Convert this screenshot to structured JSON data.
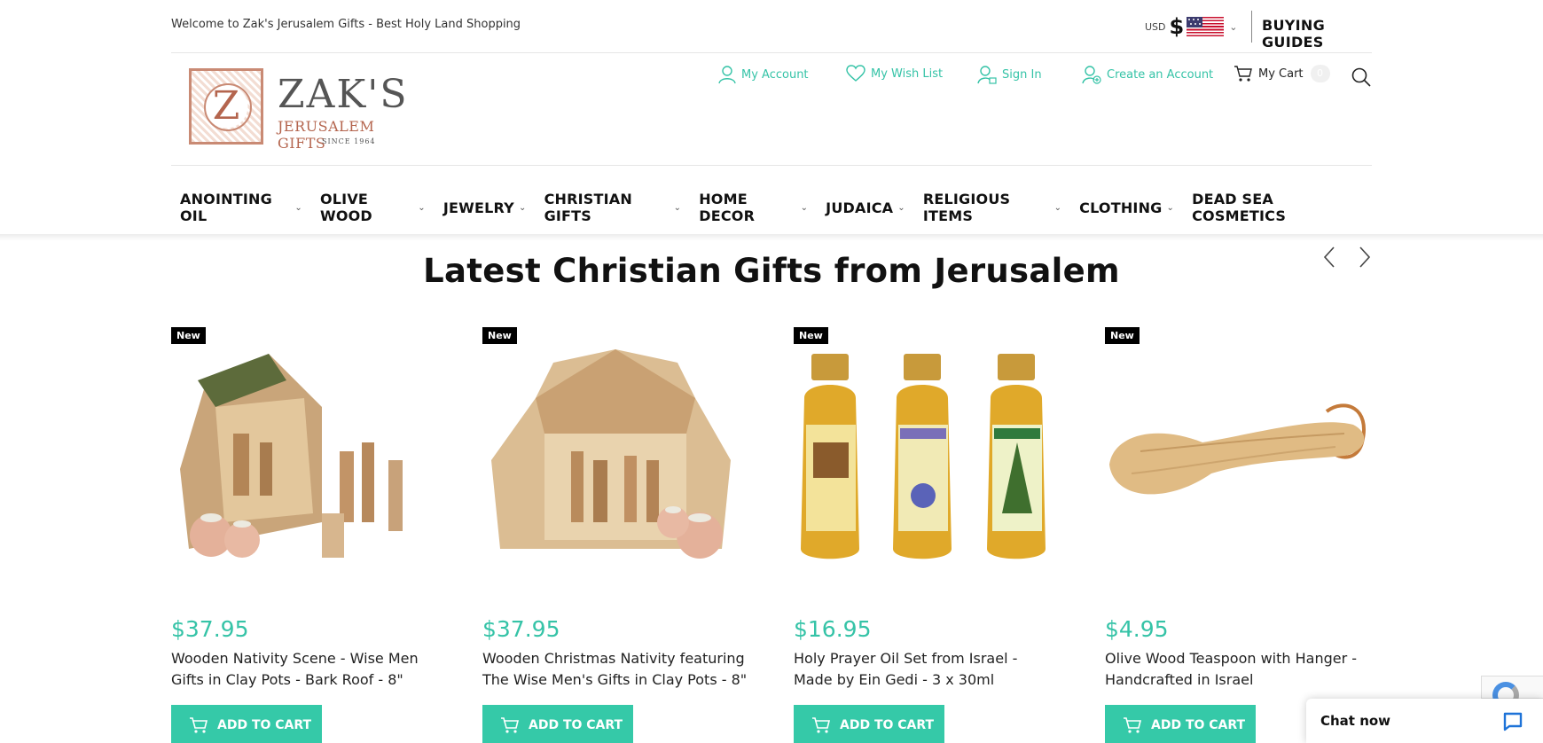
{
  "topbar": {
    "welcome": "Welcome to Zak's Jerusalem Gifts - Best Holy Land Shopping",
    "currency_code": "USD",
    "currency_symbol": "$",
    "buying_guides": "BUYING GUIDES"
  },
  "logo": {
    "mark_letter": "Z",
    "name": "ZAK'S",
    "tagline": "JERUSALEM GIFTS",
    "since": "SINCE 1964"
  },
  "account": {
    "my_account": "My Account",
    "wish_list": "My Wish List",
    "sign_in": "Sign In",
    "create_account": "Create an Account",
    "cart": "My Cart",
    "cart_count": "0"
  },
  "nav": {
    "items": [
      {
        "label": "ANOINTING OIL",
        "has_dropdown": true
      },
      {
        "label": "OLIVE WOOD",
        "has_dropdown": true
      },
      {
        "label": "JEWELRY",
        "has_dropdown": true
      },
      {
        "label": "CHRISTIAN GIFTS",
        "has_dropdown": true
      },
      {
        "label": "HOME DECOR",
        "has_dropdown": true
      },
      {
        "label": "JUDAICA",
        "has_dropdown": true
      },
      {
        "label": "RELIGIOUS ITEMS",
        "has_dropdown": true
      },
      {
        "label": "CLOTHING",
        "has_dropdown": true
      },
      {
        "label": "DEAD SEA COSMETICS",
        "has_dropdown": false
      }
    ]
  },
  "section": {
    "title": "Latest Christian Gifts from Jerusalem",
    "prev_icon": "chevron-left-icon",
    "next_icon": "chevron-right-icon"
  },
  "products": [
    {
      "badge": "New",
      "price": "$37.95",
      "name": "Wooden Nativity Scene - Wise Men Gifts in Clay Pots - Bark Roof - 8\"",
      "button": "ADD TO CART"
    },
    {
      "badge": "New",
      "price": "$37.95",
      "name": "Wooden Christmas Nativity featuring The Wise Men's Gifts in Clay Pots - 8\"",
      "button": "ADD TO CART"
    },
    {
      "badge": "New",
      "price": "$16.95",
      "name": "Holy Prayer Oil Set from Israel - Made by Ein Gedi - 3 x 30ml",
      "button": "ADD TO CART"
    },
    {
      "badge": "New",
      "price": "$4.95",
      "name": "Olive Wood Teaspoon with Hanger - Handcrafted in Israel",
      "button": "ADD TO CART"
    }
  ],
  "chat": {
    "label": "Chat now"
  },
  "colors": {
    "accent": "#35c9a8",
    "price": "#35c3a7",
    "badge_bg": "#000000",
    "logo": "#b4654e"
  }
}
